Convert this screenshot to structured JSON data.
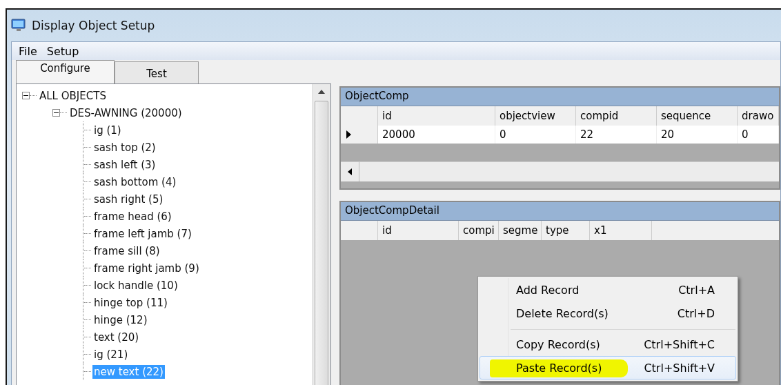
{
  "window": {
    "title": "Display Object Setup"
  },
  "menu": [
    "File",
    "Setup"
  ],
  "tabs": [
    {
      "label": "Configure",
      "selected": true
    },
    {
      "label": "Test",
      "selected": false
    }
  ],
  "tree": [
    {
      "label": "ALL OBJECTS",
      "expanded": true,
      "selected": false,
      "children": [
        {
          "label": "DES-AWNING (20000)",
          "expanded": true,
          "selected": false,
          "children": [
            {
              "label": "ig (1)",
              "selected": false
            },
            {
              "label": "sash top (2)",
              "selected": false
            },
            {
              "label": "sash left (3)",
              "selected": false
            },
            {
              "label": "sash bottom (4)",
              "selected": false
            },
            {
              "label": "sash right (5)",
              "selected": false
            },
            {
              "label": "frame head (6)",
              "selected": false
            },
            {
              "label": "frame left jamb (7)",
              "selected": false
            },
            {
              "label": "frame sill (8)",
              "selected": false
            },
            {
              "label": "frame right jamb (9)",
              "selected": false
            },
            {
              "label": "lock handle (10)",
              "selected": false
            },
            {
              "label": "hinge top (11)",
              "selected": false
            },
            {
              "label": "hinge (12)",
              "selected": false
            },
            {
              "label": "text (20)",
              "selected": false
            },
            {
              "label": "ig (21)",
              "selected": false
            },
            {
              "label": "new text (22)",
              "selected": true
            }
          ]
        }
      ]
    }
  ],
  "object_comp": {
    "title": "ObjectComp",
    "columns": [
      "id",
      "objectview",
      "compid",
      "sequence",
      "drawo"
    ],
    "rows": [
      {
        "current": true,
        "cells": [
          "20000",
          "0",
          "22",
          "20",
          "0"
        ]
      }
    ]
  },
  "object_comp_detail": {
    "title": "ObjectCompDetail",
    "columns": [
      "id",
      "compi",
      "segme",
      "type",
      "x1"
    ]
  },
  "context_menu": [
    {
      "label": "Add Record",
      "shortcut": "Ctrl+A",
      "selected": false,
      "highlighted": false,
      "separator_before": false
    },
    {
      "label": "Delete Record(s)",
      "shortcut": "Ctrl+D",
      "selected": false,
      "highlighted": false,
      "separator_before": false
    },
    {
      "label": "Copy Record(s)",
      "shortcut": "Ctrl+Shift+C",
      "selected": false,
      "highlighted": false,
      "separator_before": true
    },
    {
      "label": "Paste Record(s)",
      "shortcut": "Ctrl+Shift+V",
      "selected": true,
      "highlighted": true,
      "separator_before": false
    }
  ]
}
